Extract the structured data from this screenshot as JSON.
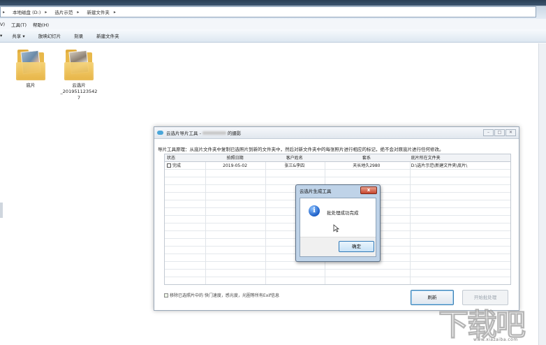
{
  "explorer": {
    "breadcrumb": [
      "本地磁盘 (D:)",
      "选片示范",
      "新建文件夹"
    ],
    "menu": [
      "V)",
      "工具(T)",
      "帮助(H)"
    ],
    "toolbar": [
      "共享 ▾",
      "放映幻灯片",
      "刻录",
      "新建文件夹"
    ],
    "files": [
      {
        "name": "底片",
        "icon": "photo-folder-icon"
      },
      {
        "name": "云选片\n_201951123542\n7",
        "icon": "photo-folder-icon"
      }
    ]
  },
  "app_window": {
    "title_prefix": "云选片导片工具 - ",
    "title_suffix": "的摄影",
    "description": "导片工具原理：从底片文件夹中复制已选照片到新的文件夹中，然后对新文件夹中的每张照片进行相应的标记，绝不会对原底片进行任何修改。",
    "columns": [
      "状态",
      "拍照日期",
      "客户姓名",
      "套系",
      "底片所在文件夹"
    ],
    "rows": [
      {
        "status": "完成",
        "date": "2019-05-02",
        "customer": "张三&李四",
        "package": "天长地久2980",
        "folder": "D:\\选片示范\\新建文件夹\\底片\\"
      }
    ],
    "option_label": "移除已选照片中的 快门速度，感光度，光圈等所有Exif信息",
    "refresh_label": "刷新",
    "process_label": "开始批处理"
  },
  "dialog": {
    "title": "云选片生成工具",
    "close_label": "x",
    "message": "批处理成功完成",
    "ok_label": "确定"
  },
  "watermark": {
    "text": "下载吧",
    "url": "www.xiazaiba.com"
  },
  "colors": {
    "accent": "#3c7fb1",
    "info": "#1d5fc7",
    "close": "#c6452c",
    "folder": "#e8b84a"
  }
}
